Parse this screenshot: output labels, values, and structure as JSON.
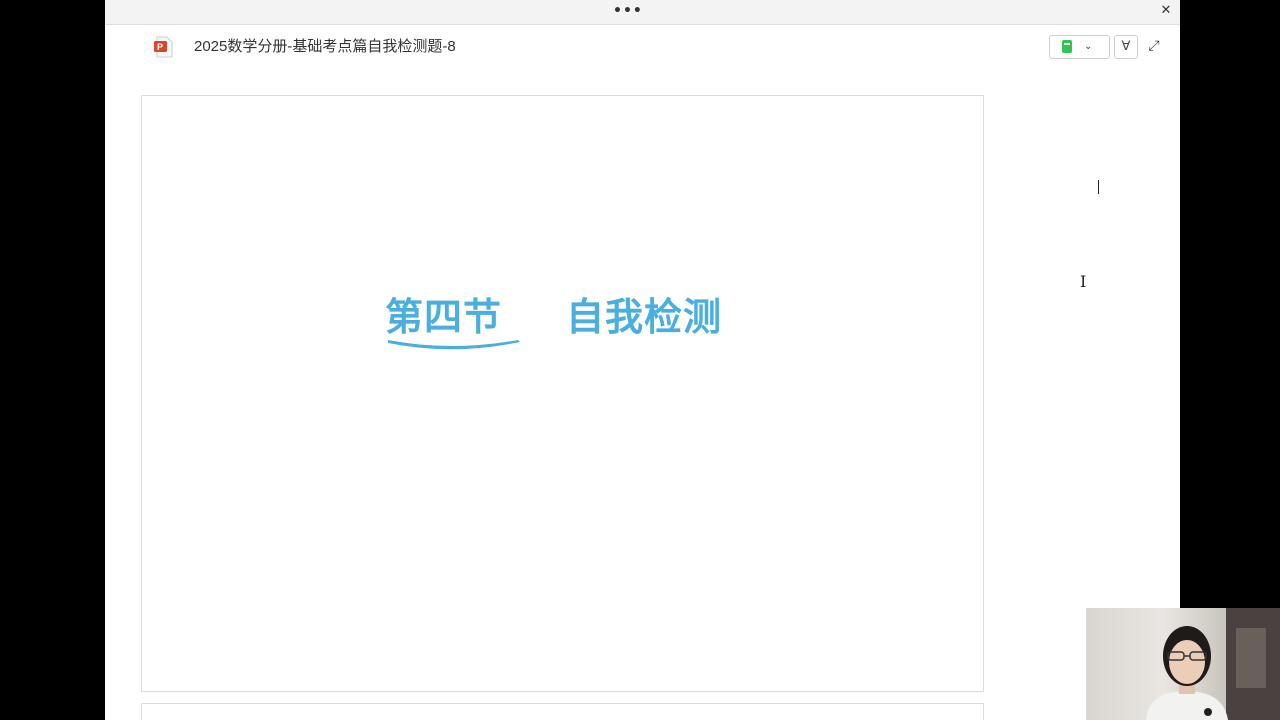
{
  "window": {
    "more_glyph": "•••",
    "close_glyph": "✕"
  },
  "header": {
    "file_icon": "ppt-file-icon",
    "title": "2025数学分册-基础考点篇自我检测题-8",
    "toolbar": {
      "notebook_icon": "green-notebook-icon",
      "dropdown_glyph": "⌄",
      "filter_glyph": "∀",
      "expand_glyph": "⤢"
    }
  },
  "slide": {
    "heading_part1": "第四节",
    "heading_part2": "自我检测",
    "accent_color": "#4aaee0"
  },
  "overlay": {
    "webcam": "presenter-webcam-feed"
  }
}
